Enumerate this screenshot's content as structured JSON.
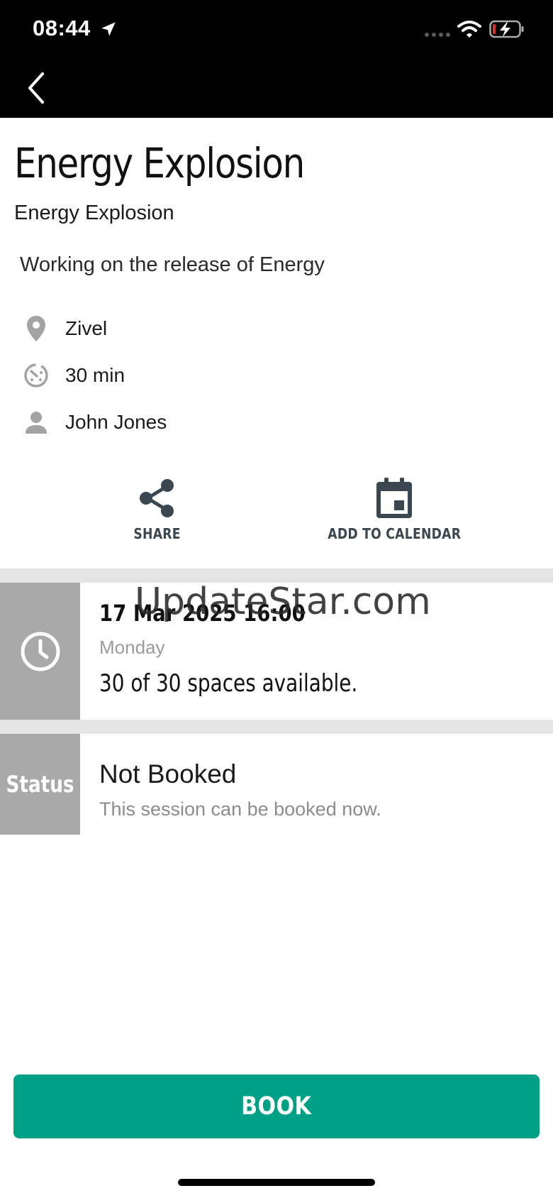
{
  "status_bar": {
    "time": "08:44"
  },
  "header": {
    "title": "Energy Explosion",
    "subtitle": "Energy Explosion",
    "description": "Working on the release of Energy"
  },
  "details": {
    "location": "Zivel",
    "duration": "30 min",
    "instructor": "John Jones"
  },
  "actions": {
    "share_label": "SHARE",
    "calendar_label": "ADD TO CALENDAR"
  },
  "session": {
    "date_time": "17 Mar 2025 16:00",
    "day": "Monday",
    "spaces": "30 of 30 spaces available."
  },
  "status_section": {
    "side_label": "Status",
    "value": "Not Booked",
    "description": "This session can be booked now."
  },
  "watermark": "UpdateStar.com",
  "book_button": {
    "label": "BOOK"
  },
  "colors": {
    "accent": "#00a086",
    "side_block": "#a9a9a9",
    "icon_gray": "#a3a3a3",
    "action_icon": "#3a4650"
  }
}
